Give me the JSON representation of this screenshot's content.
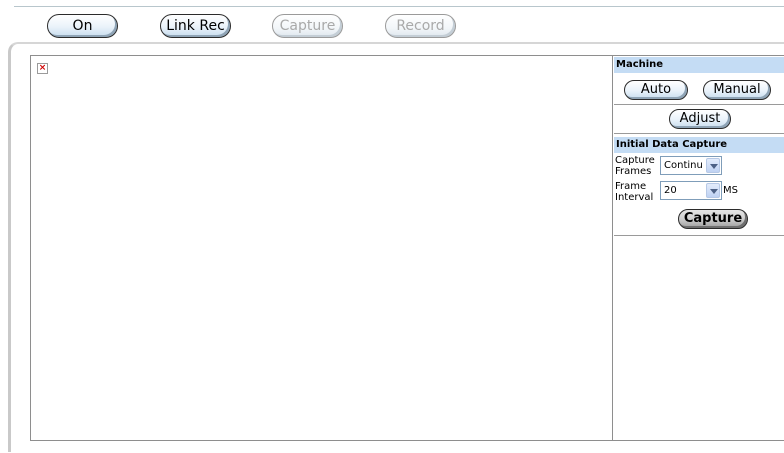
{
  "toolbar": {
    "on_label": "On",
    "link_rec_label": "Link Rec",
    "capture_label": "Capture",
    "record_label": "Record"
  },
  "machine": {
    "title": "Machine",
    "auto_label": "Auto",
    "manual_label": "Manual",
    "adjust_label": "Adjust"
  },
  "initial_capture": {
    "title": "Initial Data Capture",
    "capture_frames_label_1": "Capture",
    "capture_frames_label_2": "Frames",
    "capture_frames_value": "Continu",
    "frame_interval_label_1": "Frame",
    "frame_interval_label_2": "Interval",
    "frame_interval_value": "20",
    "unit": "MS",
    "capture_button": "Capture"
  },
  "viewport": {
    "broken_image_glyph": "×"
  }
}
